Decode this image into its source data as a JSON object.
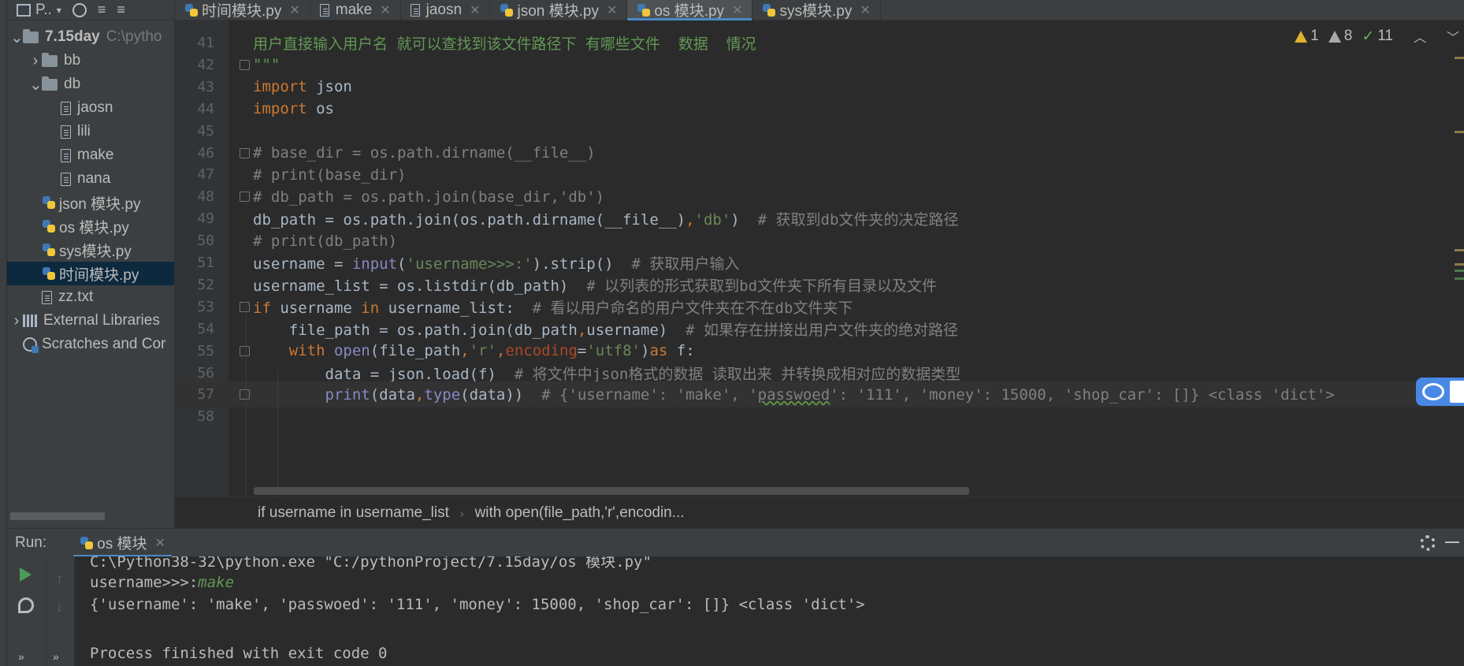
{
  "project_panel": {
    "header_title": "P..",
    "tree": [
      {
        "label": "7.15day",
        "type": "folder",
        "expanded": true,
        "indent": 0,
        "path_hint": "C:\\pytho"
      },
      {
        "label": "bb",
        "type": "folder",
        "expanded": false,
        "indent": 1
      },
      {
        "label": "db",
        "type": "folder",
        "expanded": true,
        "indent": 1
      },
      {
        "label": "jaosn",
        "type": "file",
        "indent": 2
      },
      {
        "label": "lili",
        "type": "file",
        "indent": 2
      },
      {
        "label": "make",
        "type": "file",
        "indent": 2
      },
      {
        "label": "nana",
        "type": "file",
        "indent": 2
      },
      {
        "label": "json 模块.py",
        "type": "py",
        "indent": 1
      },
      {
        "label": "os 模块.py",
        "type": "py",
        "indent": 1
      },
      {
        "label": "sys模块.py",
        "type": "py",
        "indent": 1
      },
      {
        "label": "时间模块.py",
        "type": "py",
        "indent": 1,
        "selected": true
      },
      {
        "label": "zz.txt",
        "type": "file",
        "indent": 1
      },
      {
        "label": "External Libraries",
        "type": "lib",
        "expanded": false,
        "indent": 0
      },
      {
        "label": "Scratches and Cor",
        "type": "scratch",
        "indent": 0
      }
    ]
  },
  "tabs": [
    {
      "label": "时间模块.py",
      "icon": "python-icon"
    },
    {
      "label": "make",
      "icon": "file-icon"
    },
    {
      "label": "jaosn",
      "icon": "file-icon"
    },
    {
      "label": "json 模块.py",
      "icon": "python-icon"
    },
    {
      "label": "os 模块.py",
      "icon": "python-icon",
      "active": true
    },
    {
      "label": "sys模块.py",
      "icon": "python-icon"
    }
  ],
  "inspections": {
    "errors": "1",
    "warnings": "8",
    "weak_warnings": "11"
  },
  "code_lines": [
    {
      "n": "41",
      "parts": [
        {
          "c": "doc",
          "t": "用户直接输入用户名 就可以查找到该文件路径下 有哪些文件  数据  情况"
        }
      ]
    },
    {
      "n": "42",
      "fold": true,
      "parts": [
        {
          "c": "doc",
          "t": "\"\"\""
        }
      ]
    },
    {
      "n": "43",
      "parts": [
        {
          "c": "kw",
          "t": "import"
        },
        {
          "c": "txt",
          "t": " json"
        }
      ]
    },
    {
      "n": "44",
      "parts": [
        {
          "c": "kw",
          "t": "import"
        },
        {
          "c": "txt",
          "t": " os"
        }
      ]
    },
    {
      "n": "45",
      "parts": []
    },
    {
      "n": "46",
      "fold": true,
      "parts": [
        {
          "c": "cm",
          "t": "# base_dir = os.path.dirname(__file__)"
        }
      ]
    },
    {
      "n": "47",
      "parts": [
        {
          "c": "cm",
          "t": "# print(base_dir)"
        }
      ]
    },
    {
      "n": "48",
      "fold": true,
      "parts": [
        {
          "c": "cm",
          "t": "# db_path = os.path.join(base_dir,'db')"
        }
      ]
    },
    {
      "n": "49",
      "parts": [
        {
          "c": "txt",
          "t": "db_path = os.path.join(os.path.dirname(__file__)"
        },
        {
          "c": "kw",
          "t": ","
        },
        {
          "c": "str",
          "t": "'db'"
        },
        {
          "c": "txt",
          "t": ")  "
        },
        {
          "c": "cm",
          "t": "# 获取到db文件夹的决定路径"
        }
      ]
    },
    {
      "n": "50",
      "parts": [
        {
          "c": "cm",
          "t": "# print(db_path)"
        }
      ]
    },
    {
      "n": "51",
      "parts": [
        {
          "c": "txt",
          "t": "username = "
        },
        {
          "c": "fn",
          "t": "input"
        },
        {
          "c": "txt",
          "t": "("
        },
        {
          "c": "str",
          "t": "'username>>>:'"
        },
        {
          "c": "txt",
          "t": ").strip()  "
        },
        {
          "c": "cm",
          "t": "# 获取用户输入"
        }
      ]
    },
    {
      "n": "52",
      "parts": [
        {
          "c": "txt",
          "t": "username_list = os.listdir(db_path)  "
        },
        {
          "c": "cm",
          "t": "# 以列表的形式获取到bd文件夹下所有目录以及文件"
        }
      ]
    },
    {
      "n": "53",
      "fold": true,
      "parts": [
        {
          "c": "kw",
          "t": "if"
        },
        {
          "c": "txt",
          "t": " username "
        },
        {
          "c": "kw",
          "t": "in"
        },
        {
          "c": "txt",
          "t": " username_list:  "
        },
        {
          "c": "cm",
          "t": "# 看以用户命名的用户文件夹在不在db文件夹下"
        }
      ]
    },
    {
      "n": "54",
      "parts": [
        {
          "c": "txt",
          "t": "    file_path = os.path.join(db_path"
        },
        {
          "c": "kw",
          "t": ","
        },
        {
          "c": "txt",
          "t": "username)  "
        },
        {
          "c": "cm",
          "t": "# 如果存在拼接出用户文件夹的绝对路径"
        }
      ]
    },
    {
      "n": "55",
      "fold": true,
      "parts": [
        {
          "c": "txt",
          "t": "    "
        },
        {
          "c": "kw",
          "t": "with"
        },
        {
          "c": "txt",
          "t": " "
        },
        {
          "c": "fn",
          "t": "open"
        },
        {
          "c": "txt",
          "t": "(file_path"
        },
        {
          "c": "kw",
          "t": ","
        },
        {
          "c": "str",
          "t": "'r'"
        },
        {
          "c": "kw",
          "t": ","
        },
        {
          "c": "prm",
          "t": "encoding"
        },
        {
          "c": "txt",
          "t": "="
        },
        {
          "c": "str",
          "t": "'utf8'"
        },
        {
          "c": "txt",
          "t": ")"
        },
        {
          "c": "kw",
          "t": "as"
        },
        {
          "c": "txt",
          "t": " f:"
        }
      ]
    },
    {
      "n": "56",
      "parts": [
        {
          "c": "txt",
          "t": "        data = json.load(f)  "
        },
        {
          "c": "cm",
          "t": "# 将文件中json格式的数据 读取出来 并转换成相对应的数据类型"
        }
      ]
    },
    {
      "n": "57",
      "current": true,
      "fold": true,
      "parts": [
        {
          "c": "txt",
          "t": "        "
        },
        {
          "c": "fn",
          "t": "print"
        },
        {
          "c": "txt",
          "t": "(data"
        },
        {
          "c": "kw",
          "t": ","
        },
        {
          "c": "fn",
          "t": "type"
        },
        {
          "c": "txt",
          "t": "(data))  "
        },
        {
          "c": "cm",
          "t": "# {'username': 'make', '"
        },
        {
          "c": "typo",
          "t": "passwoed"
        },
        {
          "c": "cm",
          "t": "': '111', 'money': 15000, 'shop_car': []} <class 'dict'>"
        }
      ]
    },
    {
      "n": "58",
      "parts": []
    }
  ],
  "breadcrumb": [
    "if username in username_list",
    "with open(file_path,'r',encodin..."
  ],
  "run_panel": {
    "label": "Run:",
    "tab_label": "os 模块",
    "console": {
      "line1": "C:\\Python38-32\\python.exe \"C:/pythonProject/7.15day/os 模块.py\"",
      "prompt": "username>>>:",
      "input": "make",
      "line3": "{'username': 'make', 'passwoed': '111', 'money': 15000, 'shop_car': []} <class 'dict'>",
      "line5": "Process finished with exit code 0"
    }
  },
  "colors": {
    "keyword": "#cc7832",
    "comment": "#808080",
    "string": "#6a8759",
    "builtin": "#8888c6",
    "param": "#aa4926",
    "accent": "#4a88c7"
  }
}
